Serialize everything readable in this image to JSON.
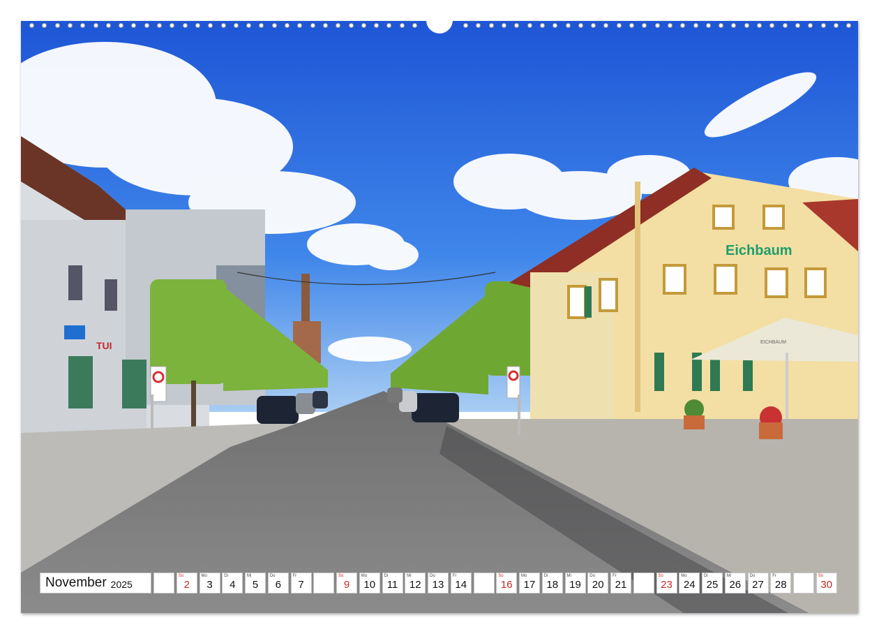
{
  "photo": {
    "shop_sign_left": "TUI",
    "building_sign": "Eichbaum",
    "umbrella_text": "EICHBAUM"
  },
  "calendar": {
    "month": "November",
    "year": "2025",
    "days": [
      {
        "num": "",
        "abbr": "",
        "sunday": false
      },
      {
        "num": "2",
        "abbr": "So",
        "sunday": true
      },
      {
        "num": "3",
        "abbr": "Mo",
        "sunday": false
      },
      {
        "num": "4",
        "abbr": "Di",
        "sunday": false
      },
      {
        "num": "5",
        "abbr": "Mi",
        "sunday": false
      },
      {
        "num": "6",
        "abbr": "Do",
        "sunday": false
      },
      {
        "num": "7",
        "abbr": "Fr",
        "sunday": false
      },
      {
        "num": "",
        "abbr": "",
        "sunday": false
      },
      {
        "num": "9",
        "abbr": "So",
        "sunday": true
      },
      {
        "num": "10",
        "abbr": "Mo",
        "sunday": false
      },
      {
        "num": "11",
        "abbr": "Di",
        "sunday": false
      },
      {
        "num": "12",
        "abbr": "Mi",
        "sunday": false
      },
      {
        "num": "13",
        "abbr": "Do",
        "sunday": false
      },
      {
        "num": "14",
        "abbr": "Fr",
        "sunday": false
      },
      {
        "num": "",
        "abbr": "",
        "sunday": false
      },
      {
        "num": "16",
        "abbr": "So",
        "sunday": true
      },
      {
        "num": "17",
        "abbr": "Mo",
        "sunday": false
      },
      {
        "num": "18",
        "abbr": "Di",
        "sunday": false
      },
      {
        "num": "19",
        "abbr": "Mi",
        "sunday": false
      },
      {
        "num": "20",
        "abbr": "Do",
        "sunday": false
      },
      {
        "num": "21",
        "abbr": "Fr",
        "sunday": false
      },
      {
        "num": "",
        "abbr": "",
        "sunday": false
      },
      {
        "num": "23",
        "abbr": "So",
        "sunday": true
      },
      {
        "num": "24",
        "abbr": "Mo",
        "sunday": false
      },
      {
        "num": "25",
        "abbr": "Di",
        "sunday": false
      },
      {
        "num": "26",
        "abbr": "Mi",
        "sunday": false
      },
      {
        "num": "27",
        "abbr": "Do",
        "sunday": false
      },
      {
        "num": "28",
        "abbr": "Fr",
        "sunday": false
      },
      {
        "num": "",
        "abbr": "",
        "sunday": false
      },
      {
        "num": "30",
        "abbr": "So",
        "sunday": true
      }
    ]
  }
}
